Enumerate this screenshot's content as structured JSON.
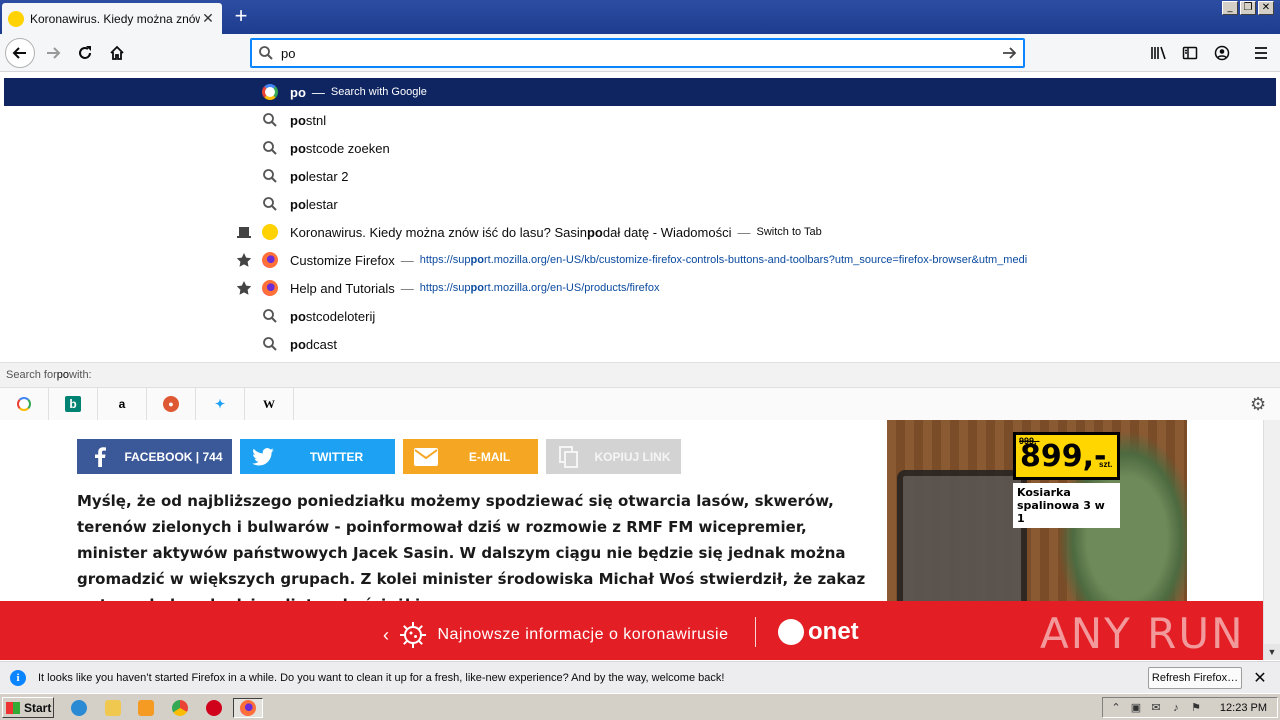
{
  "tab": {
    "title": "Koronawirus. Kiedy można znów iść do lasu? Sasin podał datę - Wiadomości",
    "close": "✕"
  },
  "newtab": "+",
  "window_buttons": [
    "_",
    "❐",
    "✕"
  ],
  "urlbar": {
    "value": "po"
  },
  "suggestions": [
    {
      "kind": "search-engine",
      "bold": "po",
      "sep": "—",
      "action": "Search with Google"
    },
    {
      "kind": "history",
      "bold": "po",
      "rest": "stnl"
    },
    {
      "kind": "history",
      "bold": "po",
      "rest": "stcode zoeken"
    },
    {
      "kind": "history",
      "bold": "po",
      "rest": "lestar 2"
    },
    {
      "kind": "history",
      "bold": "po",
      "rest": "lestar"
    },
    {
      "kind": "open-tab",
      "pre": "Koronawirus. Kiedy można znów iść do lasu? Sasin ",
      "bold": "po",
      "post": "dał datę - Wiadomości",
      "sep": "—",
      "action": "Switch to Tab"
    },
    {
      "kind": "bookmark",
      "title": "Customize Firefox",
      "sep": "—",
      "url_pre": "https://sup",
      "url_bold": "po",
      "url_post": "rt.mozilla.org/en-US/kb/customize-firefox-controls-buttons-and-toolbars?utm_source=firefox-browser&utm_medi"
    },
    {
      "kind": "bookmark",
      "title": "Help and Tutorials",
      "sep": "—",
      "url_pre": "https://sup",
      "url_bold": "po",
      "url_post": "rt.mozilla.org/en-US/products/firefox"
    },
    {
      "kind": "history",
      "bold": "po",
      "rest": "stcodeloterij"
    },
    {
      "kind": "history",
      "bold": "po",
      "rest": "dcast"
    }
  ],
  "search_for": {
    "pre": "Search for ",
    "term": "po",
    "post": " with:"
  },
  "engines": [
    "google-icon",
    "bing-icon",
    "amazon-icon",
    "duckduckgo-icon",
    "twitter-icon",
    "wikipedia-icon"
  ],
  "share": {
    "facebook": "FACEBOOK | 744",
    "twitter": "TWITTER",
    "email": "E-MAIL",
    "copy": "KOPIUJ LINK"
  },
  "article": {
    "text": "Myślę, że od najbliższego poniedziałku możemy spodziewać się otwarcia lasów, skwerów, terenów zielonych i bulwarów - poinformował dziś w rozmowie z RMF FM wicepremier, minister aktywów państwowych Jacek Sasin. W dalszym ciągu nie będzie się jednak można gromadzić w większych grupach. Z kolei minister środowiska Michał Woś stwierdził, że zakaz wstępu do lasu będzie zdjęty, ale ścieżki"
  },
  "ad": {
    "old_price": "999,-",
    "price": "899,-",
    "unit": "szt.",
    "name": "Kosiarka spalinowa 3 w 1"
  },
  "onet_bar": {
    "text": "Najnowsze informacje o koronawirusie",
    "logo": "onet",
    "watermark": "ANY RUN"
  },
  "notification": {
    "message": "It looks like you haven’t started Firefox in a while. Do you want to clean it up for a fresh, like-new experience? And by the way, welcome back!",
    "button": "Refresh Firefox…",
    "close": "✕"
  },
  "taskbar": {
    "start": "Start",
    "clock": "12:23 PM"
  },
  "colors": {
    "selected_row": "#0f2561",
    "facebook": "#3b5998",
    "twitter": "#1da1f2",
    "email": "#f5a623",
    "onet_red": "#e31e24"
  }
}
